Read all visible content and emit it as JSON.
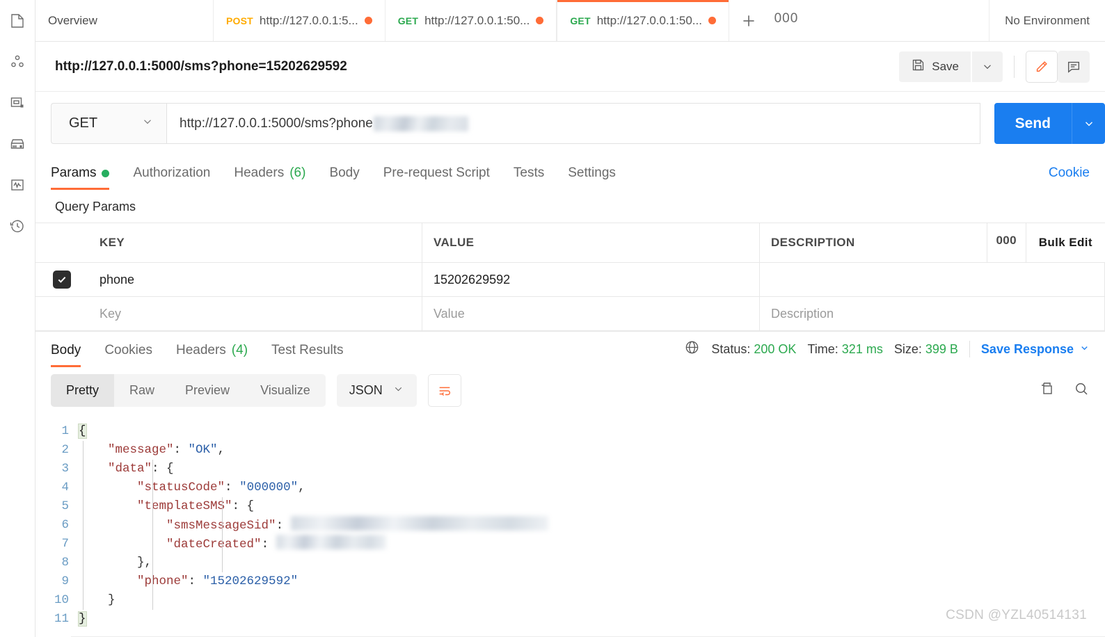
{
  "sidebar": {
    "items": [
      {
        "name": "collections",
        "icon": "collections-icon"
      },
      {
        "name": "apis",
        "icon": "apis-icon"
      },
      {
        "name": "environments",
        "icon": "environments-icon"
      },
      {
        "name": "mock-servers",
        "icon": "mock-server-icon"
      },
      {
        "name": "monitors",
        "icon": "monitor-icon"
      },
      {
        "name": "history",
        "icon": "history-icon"
      }
    ]
  },
  "tabstrip": {
    "overview_label": "Overview",
    "tabs": [
      {
        "method": "POST",
        "url": "http://127.0.0.1:5...",
        "unsaved": true,
        "active": false
      },
      {
        "method": "GET",
        "url": "http://127.0.0.1:50...",
        "unsaved": true,
        "active": false
      },
      {
        "method": "GET",
        "url": "http://127.0.0.1:50...",
        "unsaved": true,
        "active": true
      }
    ],
    "new_tab_label": "+",
    "more_label": "000",
    "environment_label": "No Environment"
  },
  "request": {
    "title": "http://127.0.0.1:5000/sms?phone=15202629592",
    "save_label": "Save",
    "method": "GET",
    "url_visible": "http://127.0.0.1:5000/sms?phone",
    "send_label": "Send"
  },
  "request_tabs": {
    "items": [
      {
        "label": "Params",
        "badge": "",
        "dot": true,
        "active": true
      },
      {
        "label": "Authorization",
        "badge": "",
        "dot": false,
        "active": false
      },
      {
        "label": "Headers",
        "badge": "(6)",
        "dot": false,
        "active": false
      },
      {
        "label": "Body",
        "badge": "",
        "dot": false,
        "active": false
      },
      {
        "label": "Pre-request Script",
        "badge": "",
        "dot": false,
        "active": false
      },
      {
        "label": "Tests",
        "badge": "",
        "dot": false,
        "active": false
      },
      {
        "label": "Settings",
        "badge": "",
        "dot": false,
        "active": false
      }
    ],
    "cookies_label": "Cookie"
  },
  "query_params": {
    "section_label": "Query Params",
    "columns": [
      "KEY",
      "VALUE",
      "DESCRIPTION"
    ],
    "more_label": "000",
    "bulk_edit_label": "Bulk Edit",
    "rows": [
      {
        "enabled": true,
        "key": "phone",
        "value": "15202629592",
        "description": ""
      }
    ],
    "placeholders": {
      "key": "Key",
      "value": "Value",
      "description": "Description"
    }
  },
  "response": {
    "tabs": [
      {
        "label": "Body",
        "badge": "",
        "active": true
      },
      {
        "label": "Cookies",
        "badge": "",
        "active": false
      },
      {
        "label": "Headers",
        "badge": "(4)",
        "active": false
      },
      {
        "label": "Test Results",
        "badge": "",
        "active": false
      }
    ],
    "status_label": "Status:",
    "status_value": "200 OK",
    "time_label": "Time:",
    "time_value": "321 ms",
    "size_label": "Size:",
    "size_value": "399 B",
    "save_response_label": "Save Response",
    "format_tabs": [
      {
        "label": "Pretty",
        "active": true
      },
      {
        "label": "Raw",
        "active": false
      },
      {
        "label": "Preview",
        "active": false
      },
      {
        "label": "Visualize",
        "active": false
      }
    ],
    "language": "JSON",
    "code_lines": [
      {
        "n": "1",
        "segments": [
          {
            "t": "{",
            "c": "brace-hl"
          }
        ]
      },
      {
        "n": "2",
        "segments": [
          {
            "t": "    ",
            "c": "p"
          },
          {
            "t": "\"message\"",
            "c": "k"
          },
          {
            "t": ": ",
            "c": "p"
          },
          {
            "t": "\"OK\"",
            "c": "s"
          },
          {
            "t": ",",
            "c": "p"
          }
        ]
      },
      {
        "n": "3",
        "segments": [
          {
            "t": "    ",
            "c": "p"
          },
          {
            "t": "\"data\"",
            "c": "k"
          },
          {
            "t": ": {",
            "c": "p"
          }
        ]
      },
      {
        "n": "4",
        "segments": [
          {
            "t": "        ",
            "c": "p"
          },
          {
            "t": "\"statusCode\"",
            "c": "k"
          },
          {
            "t": ": ",
            "c": "p"
          },
          {
            "t": "\"000000\"",
            "c": "s"
          },
          {
            "t": ",",
            "c": "p"
          }
        ]
      },
      {
        "n": "5",
        "segments": [
          {
            "t": "        ",
            "c": "p"
          },
          {
            "t": "\"templateSMS\"",
            "c": "k"
          },
          {
            "t": ": {",
            "c": "p"
          }
        ]
      },
      {
        "n": "6",
        "segments": [
          {
            "t": "            ",
            "c": "p"
          },
          {
            "t": "\"smsMessageSid\"",
            "c": "k"
          },
          {
            "t": ": ",
            "c": "p"
          },
          {
            "t": "",
            "c": "blur-a"
          }
        ]
      },
      {
        "n": "7",
        "segments": [
          {
            "t": "            ",
            "c": "p"
          },
          {
            "t": "\"dateCreated\"",
            "c": "k"
          },
          {
            "t": ": ",
            "c": "p"
          },
          {
            "t": "",
            "c": "blur-b"
          }
        ]
      },
      {
        "n": "8",
        "segments": [
          {
            "t": "        },",
            "c": "p"
          }
        ]
      },
      {
        "n": "9",
        "segments": [
          {
            "t": "        ",
            "c": "p"
          },
          {
            "t": "\"phone\"",
            "c": "k"
          },
          {
            "t": ": ",
            "c": "p"
          },
          {
            "t": "\"15202629592\"",
            "c": "s"
          }
        ]
      },
      {
        "n": "10",
        "segments": [
          {
            "t": "    }",
            "c": "p"
          }
        ]
      },
      {
        "n": "11",
        "segments": [
          {
            "t": "}",
            "c": "brace-hl"
          }
        ]
      }
    ]
  },
  "watermark": "CSDN @YZL40514131",
  "colors": {
    "accent_orange": "#ff6c37",
    "send_blue": "#1a7ef0",
    "status_green": "#2ca94f",
    "method_get": "#2ca94f",
    "method_post": "#ffab00"
  }
}
